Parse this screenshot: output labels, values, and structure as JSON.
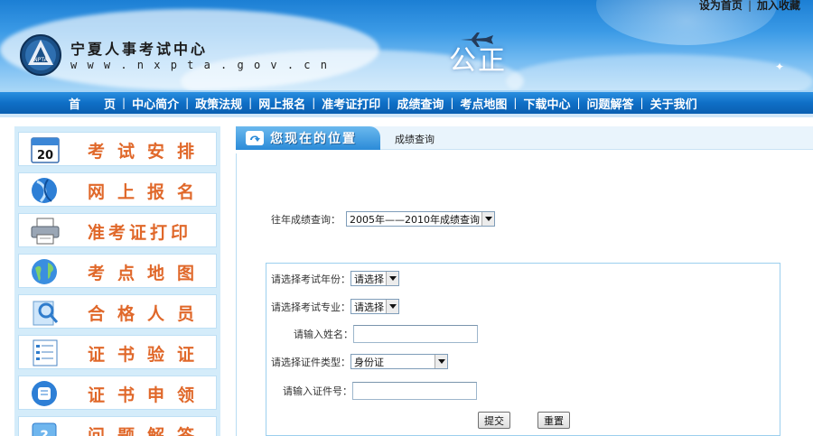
{
  "header": {
    "top_links": [
      "设为首页",
      "加入收藏"
    ],
    "logo_name": "宁夏人事考试中心",
    "logo_url": "w w w . n x p t a . g o v . c n",
    "slogan": "公正"
  },
  "nav": {
    "items": [
      "首　　页",
      "中心简介",
      "政策法规",
      "网上报名",
      "准考证打印",
      "成绩查询",
      "考点地图",
      "下载中心",
      "问题解答",
      "关于我们"
    ]
  },
  "sidebar": {
    "items": [
      {
        "label": "考试安排",
        "icon": "calendar-icon",
        "icon_text": "20"
      },
      {
        "label": "网上报名",
        "icon": "globe-icon"
      },
      {
        "label": "准考证打印",
        "icon": "printer-icon"
      },
      {
        "label": "考点地图",
        "icon": "earth-icon"
      },
      {
        "label": "合格人员",
        "icon": "search-user-icon"
      },
      {
        "label": "证书验证",
        "icon": "list-icon"
      },
      {
        "label": "证书申领",
        "icon": "scroll-icon"
      },
      {
        "label": "问题解答",
        "icon": "question-icon"
      }
    ]
  },
  "location": {
    "title": "您现在的位置",
    "crumb": "成绩查询"
  },
  "history": {
    "label": "往年成绩查询：",
    "selected": "2005年——2010年成绩查询"
  },
  "form": {
    "year_label": "请选择考试年份：",
    "year_selected": "请选择",
    "major_label": "请选择考试专业：",
    "major_selected": "请选择",
    "name_label": "请输入姓名：",
    "name_value": "",
    "id_type_label": "请选择证件类型：",
    "id_type_selected": "身份证",
    "id_number_label": "请输入证件号：",
    "id_number_value": "",
    "submit_label": "提交",
    "reset_label": "重置"
  },
  "colors": {
    "nav_bg": "#0f6fc6",
    "sidebar_bg": "#d4ecfa",
    "sidebar_label": "#e0682a",
    "panel_border": "#9ccfee"
  }
}
